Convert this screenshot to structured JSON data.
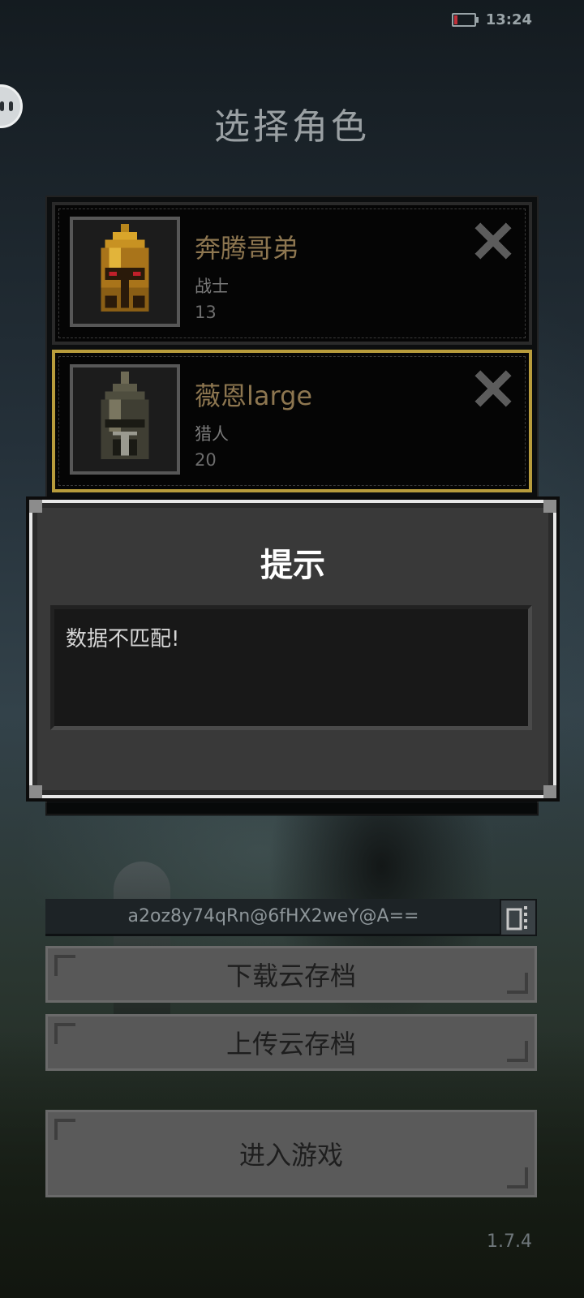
{
  "status_bar": {
    "time": "13:24",
    "battery_icon": "battery-low-icon",
    "battery_level": 0.15
  },
  "title": "选择角色",
  "characters": [
    {
      "name": "奔腾哥弟",
      "class": "战士",
      "level": "13",
      "selected": false,
      "portrait_icon": "warrior-helmet-icon"
    },
    {
      "name": "薇恩large",
      "class": "猎人",
      "level": "20",
      "selected": true,
      "portrait_icon": "hunter-helmet-icon"
    }
  ],
  "dialog": {
    "title": "提示",
    "message": "数据不匹配!"
  },
  "save_id": {
    "value": "a2oz8y74qRn@6fHX2weY@A==",
    "copy_icon": "copy-icon"
  },
  "buttons": {
    "download": "下载云存档",
    "upload": "上传云存档",
    "enter": "进入游戏"
  },
  "version": "1.7.4",
  "colors": {
    "name_gold": "#8d7650",
    "selected_border": "#b89c3c",
    "dialog_bg": "#393939",
    "button_bg": "#585858"
  }
}
